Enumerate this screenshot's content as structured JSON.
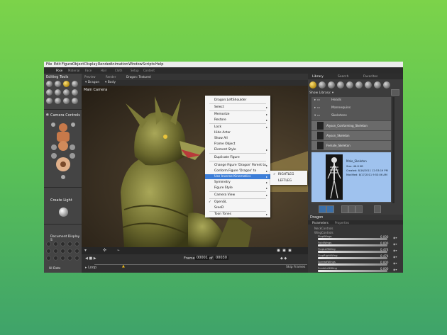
{
  "menubar": {
    "items": [
      "File",
      "Edit",
      "Figure",
      "Object",
      "Display",
      "Render",
      "Animation",
      "Window",
      "Scripts",
      "Help"
    ]
  },
  "ribbon": {
    "tabs": [
      "Pose",
      "Material",
      "Face",
      "Hair",
      "Cloth",
      "Setup",
      "Content"
    ]
  },
  "left_panel": {
    "editing_tools_title": "Editing Tools",
    "camera_controls_title": "Camera Controls",
    "create_light_title": "Create Light",
    "document_display_title": "Document Display S",
    "ui_dots_label": "UI Dots"
  },
  "document": {
    "tabs": [
      "Preview",
      "Render"
    ],
    "title": "Dragon: Textured",
    "figure_dropdown": "Dragon",
    "actor_dropdown": "Body",
    "camera_label": "Main Camera"
  },
  "context_menu": {
    "items": [
      {
        "label": "Dragon:LeftShoulder",
        "arrow": ""
      },
      {
        "label": "Select",
        "arrow": "▸"
      },
      {
        "label": "Memorize",
        "arrow": "▸"
      },
      {
        "label": "Restore",
        "arrow": "▸"
      },
      {
        "label": "Lock",
        "arrow": "▸"
      },
      {
        "label": "Hide Actor",
        "arrow": ""
      },
      {
        "label": "Show All",
        "arrow": ""
      },
      {
        "label": "Frame Object",
        "arrow": ""
      },
      {
        "label": "Element Style",
        "arrow": "▸"
      },
      {
        "label": "Duplicate Figure",
        "arrow": ""
      },
      {
        "label": "Change Figure 'Dragon' Parent to",
        "arrow": "▸"
      },
      {
        "label": "Conform Figure 'Dragon' to",
        "arrow": "▸"
      },
      {
        "label": "Use Inverse Kinematics",
        "arrow": "▸"
      },
      {
        "label": "Symmetry",
        "arrow": "▸"
      },
      {
        "label": "Figure Style",
        "arrow": "▸"
      },
      {
        "label": "Camera View",
        "arrow": "▸"
      },
      {
        "label": "OpenGL",
        "arrow": ""
      },
      {
        "label": "SreeD",
        "arrow": ""
      },
      {
        "label": "Toon Tones",
        "arrow": "▸"
      }
    ],
    "submenu": [
      "RIGHTLEG",
      "LEFTLEG"
    ],
    "check": "✓"
  },
  "timeline": {
    "frame_label": "Frame",
    "frame_current": "00001",
    "of_label": "of",
    "frame_total": "00030",
    "loop_label": "Loop",
    "skip_frames_label": "Skip Frames"
  },
  "right_panel": {
    "tabs": [
      "Library",
      "Search",
      "Favorites"
    ],
    "show_library": "Show Library:",
    "tree": [
      {
        "label": "Heads"
      },
      {
        "label": "Mannequins"
      },
      {
        "label": "Skeletons"
      }
    ],
    "items": [
      "Alyson_Conforming_Skeleton",
      "Alyson_Skeleton",
      "Female_Skeleton",
      "Male_Skeleton"
    ],
    "selected_details": {
      "size": "Size:  46.8 KB",
      "created": "Created:  8/16/2011 12:53:19 PM",
      "modified": "Modified:  8/17/2011 9:53:06 AM"
    },
    "props_title": "Dragon",
    "props_tabs": [
      "Parameters",
      "Properties"
    ],
    "groups": [
      "NeckControls",
      "WingControls"
    ],
    "params": [
      {
        "name": "FlapWings",
        "value": "0.000"
      },
      {
        "name": "FoldWings",
        "value": "0.000"
      },
      {
        "name": "FlapLeftWing",
        "value": "0.474"
      },
      {
        "name": "FlapRightWing",
        "value": "0.474"
      },
      {
        "name": "SpreadWings",
        "value": "0.000"
      },
      {
        "name": "ScaleLeftWing",
        "value": "0.000"
      }
    ]
  },
  "colors": {
    "accent": "#3d7ed8",
    "selection_gold": "#e8b81a",
    "panel_dark": "#3d3d3d"
  }
}
